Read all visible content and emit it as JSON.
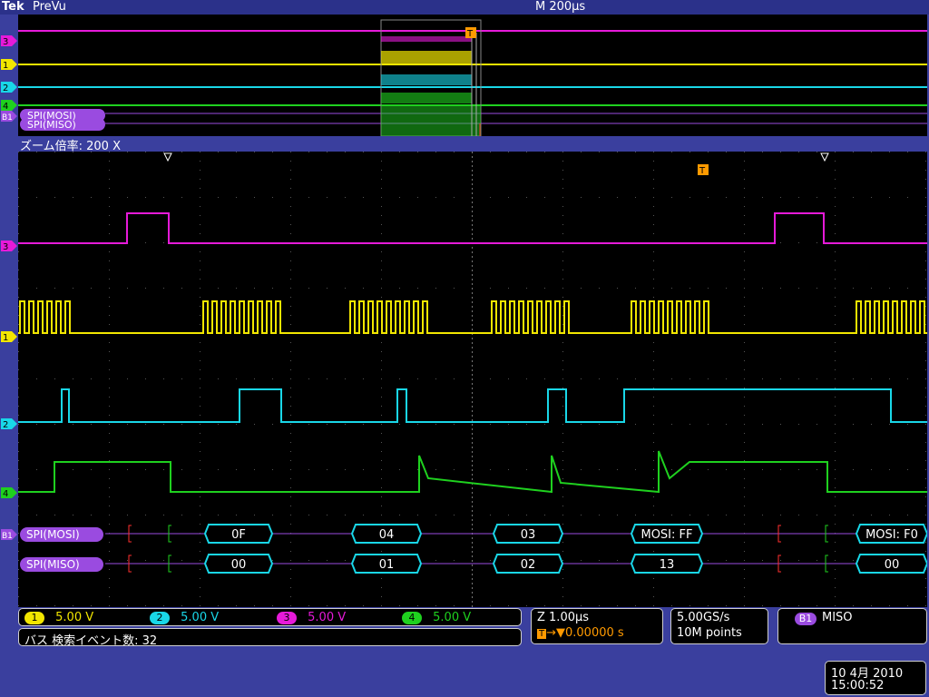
{
  "header": {
    "brand": "Tek",
    "mode": "PreVu",
    "timebase": "M 200µs"
  },
  "zoom": {
    "label": "ズーム倍率: 200 X"
  },
  "colors": {
    "ch1": "#f2e600",
    "ch2": "#19d7e8",
    "ch3": "#e61ad9",
    "ch4": "#1fd11f",
    "bus": "#9a4be0",
    "accent": "#ff9a00"
  },
  "markers": {
    "ch3": "3",
    "ch1": "1",
    "ch2": "2",
    "ch4": "4",
    "bus": "B1",
    "trigger": "T"
  },
  "bus": {
    "mosi_label": "SPI(MOSI)",
    "miso_label": "SPI(MISO)",
    "mosi_values": [
      "0F",
      "04",
      "03",
      "MOSI: FF",
      "MOSI: F0"
    ],
    "miso_values": [
      "00",
      "01",
      "02",
      "13",
      "00"
    ]
  },
  "channels": [
    {
      "id": "1",
      "scale": "5.00 V"
    },
    {
      "id": "2",
      "scale": "5.00 V"
    },
    {
      "id": "3",
      "scale": "5.00 V"
    },
    {
      "id": "4",
      "scale": "5.00 V"
    }
  ],
  "search": {
    "label": "バス 検索イベント数: 32"
  },
  "horizontal": {
    "zoom_scale": "Z 1.00µs",
    "trigger_pos": "→▼0.00000 s"
  },
  "acquisition": {
    "sample_rate": "5.00GS/s",
    "record_length": "10M points"
  },
  "trigger": {
    "source": "B1",
    "type": "MISO"
  },
  "datetime": {
    "date": "10 4月 2010",
    "time": "15:00:52"
  }
}
